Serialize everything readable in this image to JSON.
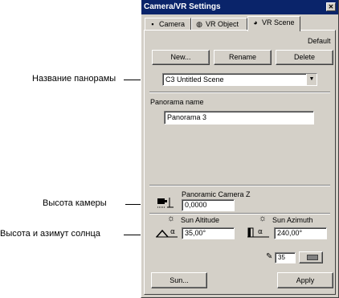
{
  "annotations": {
    "panorama_name": "Название панорамы",
    "camera_height": "Высота камеры",
    "sun_altitude_azimuth": "Высота и азимут солнца"
  },
  "window": {
    "title": "Camera/VR Settings",
    "close_glyph": "✕"
  },
  "tabs": [
    {
      "label": "Camera",
      "icon": "camera-icon",
      "glyph": "▪"
    },
    {
      "label": "VR Object",
      "icon": "vr-object-icon",
      "glyph": "◍"
    },
    {
      "label": "VR Scene",
      "icon": "vr-scene-icon",
      "glyph": "◕"
    }
  ],
  "scene": {
    "default_label": "Default",
    "new_button": "New...",
    "rename_button": "Rename",
    "delete_button": "Delete",
    "scene_select_value": "C3  Untitled Scene",
    "dropdown_glyph": "▼"
  },
  "panorama": {
    "name_label": "Panorama name",
    "name_value": "Panorama 3"
  },
  "camera": {
    "z_label": "Panoramic Camera Z",
    "z_value": "0,0000"
  },
  "sun": {
    "altitude_label": "Sun Altitude",
    "altitude_value": "35,00°",
    "azimuth_label": "Sun Azimuth",
    "azimuth_value": "240,00°"
  },
  "footer": {
    "scale_value": "35",
    "sun_button": "Sun...",
    "apply_button": "Apply"
  }
}
